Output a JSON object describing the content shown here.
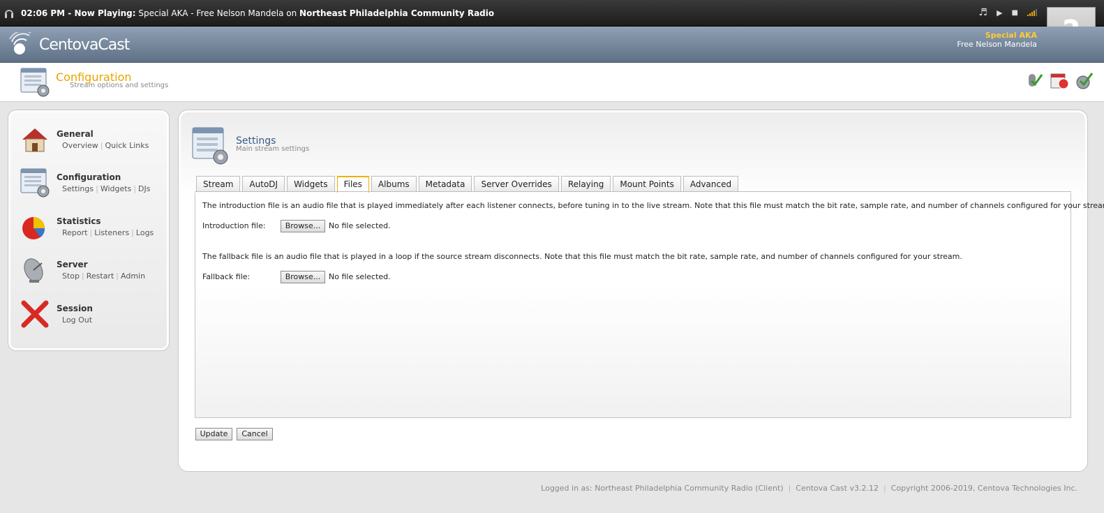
{
  "now_playing_bar": {
    "time": "02:06 PM - Now Playing:",
    "track": "Special AKA - Free Nelson Mandela",
    "on_word": "on",
    "station": "Northeast Philadelphia Community Radio",
    "controls": {
      "music": "♬",
      "play": "▶",
      "stop": "■"
    },
    "signal_color": "#e8a800"
  },
  "brand": {
    "name": "CentovaCast"
  },
  "current_track": {
    "artist": "Special AKA",
    "title": "Free Nelson Mandela"
  },
  "album_art_placeholder": "?",
  "page": {
    "title": "Configuration",
    "subtitle": "Stream options and settings"
  },
  "sidebar": {
    "groups": [
      {
        "title": "General",
        "links": [
          "Overview",
          "Quick Links"
        ],
        "icon": "home-icon"
      },
      {
        "title": "Configuration",
        "links": [
          "Settings",
          "Widgets",
          "DJs"
        ],
        "icon": "configuration-icon"
      },
      {
        "title": "Statistics",
        "links": [
          "Report",
          "Listeners",
          "Logs"
        ],
        "icon": "pie-chart-icon"
      },
      {
        "title": "Server",
        "links": [
          "Stop",
          "Restart",
          "Admin"
        ],
        "icon": "satellite-dish-icon"
      },
      {
        "title": "Session",
        "links": [
          "Log Out"
        ],
        "icon": "red-x-icon"
      }
    ]
  },
  "settings": {
    "title": "Settings",
    "subtitle": "Main stream settings",
    "tabs": [
      "Stream",
      "AutoDJ",
      "Widgets",
      "Files",
      "Albums",
      "Metadata",
      "Server Overrides",
      "Relaying",
      "Mount Points",
      "Advanced"
    ],
    "active_tab": "Files",
    "intro_text": "The introduction file is an audio file that is played immediately after each listener connects, before tuning in to the live stream. Note that this file must match the bit rate, sample rate, and number of channels configured for your stream.",
    "intro_label": "Introduction file:",
    "fallback_text": "The fallback file is an audio file that is played in a loop if the source stream disconnects. Note that this file must match the bit rate, sample rate, and number of channels configured for your stream.",
    "fallback_label": "Fallback file:",
    "browse_label": "Browse...",
    "no_file": "No file selected."
  },
  "buttons": {
    "update": "Update",
    "cancel": "Cancel"
  },
  "footer": {
    "logged_in": "Logged in as: Northeast Philadelphia Community Radio (Client)",
    "version": "Centova Cast v3.2.12",
    "copyright": "Copyright 2006-2019, Centova Technologies Inc."
  },
  "colors": {
    "accent": "#e8a400",
    "heading_blue": "#3a5a86"
  }
}
